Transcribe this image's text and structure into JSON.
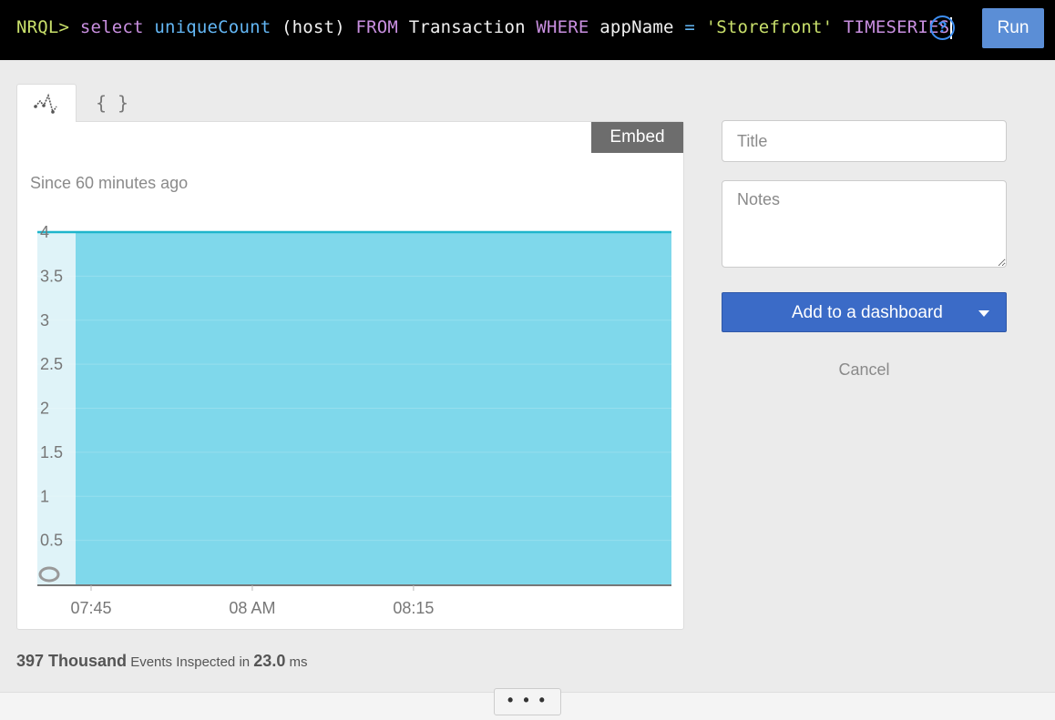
{
  "query": {
    "prompt": "NRQL>",
    "tokens": [
      {
        "t": "select",
        "c": "q-kw"
      },
      {
        "t": "uniqueCount",
        "c": "q-fn"
      },
      {
        "t": "(host)",
        "c": "q-plain"
      },
      {
        "t": "FROM",
        "c": "q-kw"
      },
      {
        "t": "Transaction",
        "c": "q-plain"
      },
      {
        "t": "WHERE",
        "c": "q-kw"
      },
      {
        "t": "appName",
        "c": "q-plain"
      },
      {
        "t": "=",
        "c": "q-op"
      },
      {
        "t": "'Storefront'",
        "c": "q-str"
      },
      {
        "t": "TIMESERIES",
        "c": "q-kw"
      }
    ],
    "help_icon": "question-circle-icon",
    "run_label": "Run"
  },
  "tabs": {
    "chart_icon": "line-chart-icon",
    "json_label": "{ }"
  },
  "panel": {
    "embed_label": "Embed",
    "since_text": "Since 60 minutes ago"
  },
  "stats": {
    "count": "397 Thousand",
    "middle": "Events Inspected in",
    "duration": "23.0",
    "unit": "ms"
  },
  "form": {
    "title_placeholder": "Title",
    "notes_placeholder": "Notes",
    "add_label": "Add to a dashboard",
    "cancel_label": "Cancel"
  },
  "footer": {
    "more_label": "• • •"
  },
  "colors": {
    "area_fill": "#7fd8eb",
    "area_line": "#1fb5cc",
    "highlight": "#dff3f8",
    "run_button": "#5b8ed6",
    "add_button": "#3b6bc7"
  },
  "chart_data": {
    "type": "area",
    "title": "",
    "xlabel": "",
    "ylabel": "",
    "ylim": [
      0,
      4
    ],
    "yticks": [
      "0.5",
      "1",
      "1.5",
      "2",
      "2.5",
      "3",
      "3.5",
      "4"
    ],
    "ytick_values": [
      0.5,
      1,
      1.5,
      2,
      2.5,
      3,
      3.5,
      4
    ],
    "xticks": [
      "07:45",
      "08 AM",
      "08:15"
    ],
    "x": [
      "07:40",
      "08:39"
    ],
    "series": [
      {
        "values": [
          4,
          4
        ]
      }
    ],
    "grid": true,
    "legend": "none"
  }
}
